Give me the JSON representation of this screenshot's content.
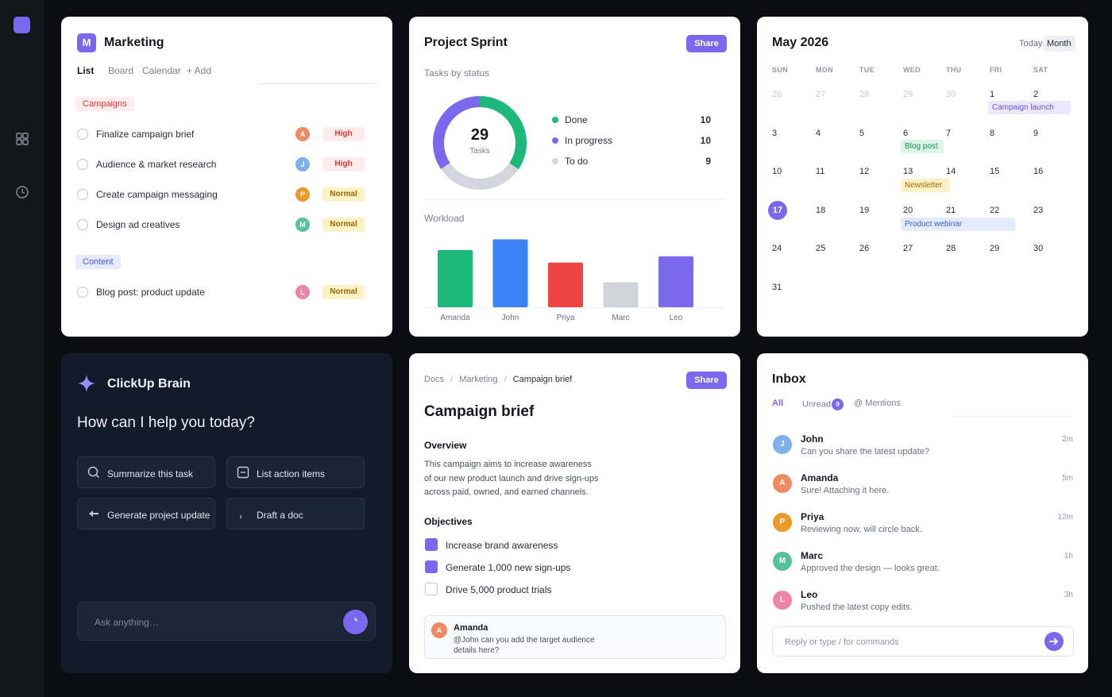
{
  "sidebar": {
    "icons": [
      "grid-icon",
      "clock-icon"
    ]
  },
  "colors": {
    "accent": "#7b68ee",
    "done": "#1db97a",
    "in_progress": "#7b68ee",
    "todo": "#d3d6de"
  },
  "marketing": {
    "logo_letter": "M",
    "title": "Marketing",
    "tabs": [
      "List",
      "Board",
      "Calendar",
      "+ Add"
    ],
    "groups": [
      {
        "name": "Campaigns",
        "tasks": [
          {
            "label": "Finalize campaign brief",
            "avatar": "A",
            "priority": "High"
          },
          {
            "label": "Audience & market research",
            "avatar": "J",
            "priority": "High"
          },
          {
            "label": "Create campaign messaging",
            "avatar": "P",
            "priority": "Normal"
          },
          {
            "label": "Design ad creatives",
            "avatar": "M",
            "priority": "Normal"
          }
        ]
      },
      {
        "name": "Content",
        "tasks": [
          {
            "label": "Blog post: product update",
            "avatar": "L",
            "priority": "Normal"
          }
        ]
      }
    ]
  },
  "sprint": {
    "title": "Project Sprint",
    "share": "Share",
    "status_label": "Tasks by status",
    "total": "29",
    "total_label": "Tasks",
    "workload_label": "Workload"
  },
  "chart_data": [
    {
      "type": "pie",
      "title": "Tasks by status",
      "categories": [
        "Done",
        "In progress",
        "To do"
      ],
      "values": [
        10,
        10,
        9
      ],
      "colors": [
        "#1db97a",
        "#7b68ee",
        "#d3d6de"
      ]
    },
    {
      "type": "bar",
      "title": "Workload",
      "categories": [
        "Amanda",
        "John",
        "Priya",
        "Marc",
        "Leo"
      ],
      "values": [
        64,
        76,
        50,
        28,
        57
      ],
      "colors": [
        "#1db97a",
        "#3b82f6",
        "#ef4444",
        "#d1d5db",
        "#7b68ee"
      ],
      "grid": false
    }
  ],
  "calendar": {
    "title": "May 2026",
    "today_btn": "Today",
    "month_btn": "Month",
    "weekdays": [
      "SUN",
      "MON",
      "TUE",
      "WED",
      "THU",
      "FRI",
      "SAT"
    ],
    "weeks": [
      [
        "26",
        "27",
        "28",
        "29",
        "30",
        "1",
        "2"
      ],
      [
        "3",
        "4",
        "5",
        "6",
        "7",
        "8",
        "9"
      ],
      [
        "10",
        "11",
        "12",
        "13",
        "14",
        "15",
        "16"
      ],
      [
        "17",
        "18",
        "19",
        "20",
        "21",
        "22",
        "23"
      ],
      [
        "24",
        "25",
        "26",
        "27",
        "28",
        "29",
        "30"
      ],
      [
        "31"
      ]
    ],
    "events": {
      "campaign_launch": "Campaign launch",
      "blog_post": "Blog post",
      "newsletter": "Newsletter",
      "product_webinar": "Product webinar"
    }
  },
  "brain": {
    "title": "ClickUp Brain",
    "prompt": "How can I help you today?",
    "actions": [
      "Summarize this task",
      "List action items",
      "Generate project update",
      "Draft a doc"
    ],
    "input_placeholder": "Ask anything…"
  },
  "doc": {
    "breadcrumb": [
      "Docs",
      "Marketing",
      "Campaign brief"
    ],
    "breadcrumb_sep": "/",
    "share": "Share",
    "title": "Campaign brief",
    "overview_heading": "Overview",
    "overview_lines": [
      "This campaign aims to increase awareness",
      "of our new product launch and drive sign-ups",
      "across paid, owned, and earned channels."
    ],
    "objectives_heading": "Objectives",
    "objectives": [
      {
        "label": "Increase brand awareness",
        "checked": true
      },
      {
        "label": "Generate 1,000 new sign-ups",
        "checked": true
      },
      {
        "label": "Drive 5,000 product trials",
        "checked": false
      }
    ],
    "comment": {
      "avatar": "A",
      "author": "Amanda",
      "lines": [
        "@John can you add the target audience",
        "details here?"
      ]
    }
  },
  "inbox": {
    "title": "Inbox",
    "tabs": {
      "all": "All",
      "unread": "Unread",
      "unread_count": "9",
      "mentions": "@ Mentions"
    },
    "messages": [
      {
        "avatar": "J",
        "name": "John",
        "text": "Can you share the latest update?",
        "time": "2m"
      },
      {
        "avatar": "A",
        "name": "Amanda",
        "text": "Sure! Attaching it here.",
        "time": "5m"
      },
      {
        "avatar": "P",
        "name": "Priya",
        "text": "Reviewing now, will circle back.",
        "time": "12m"
      },
      {
        "avatar": "M",
        "name": "Marc",
        "text": "Approved the design — looks great.",
        "time": "1h"
      },
      {
        "avatar": "L",
        "name": "Leo",
        "text": "Pushed the latest copy edits.",
        "time": "3h"
      }
    ],
    "reply_placeholder": "Reply or type / for commands"
  }
}
